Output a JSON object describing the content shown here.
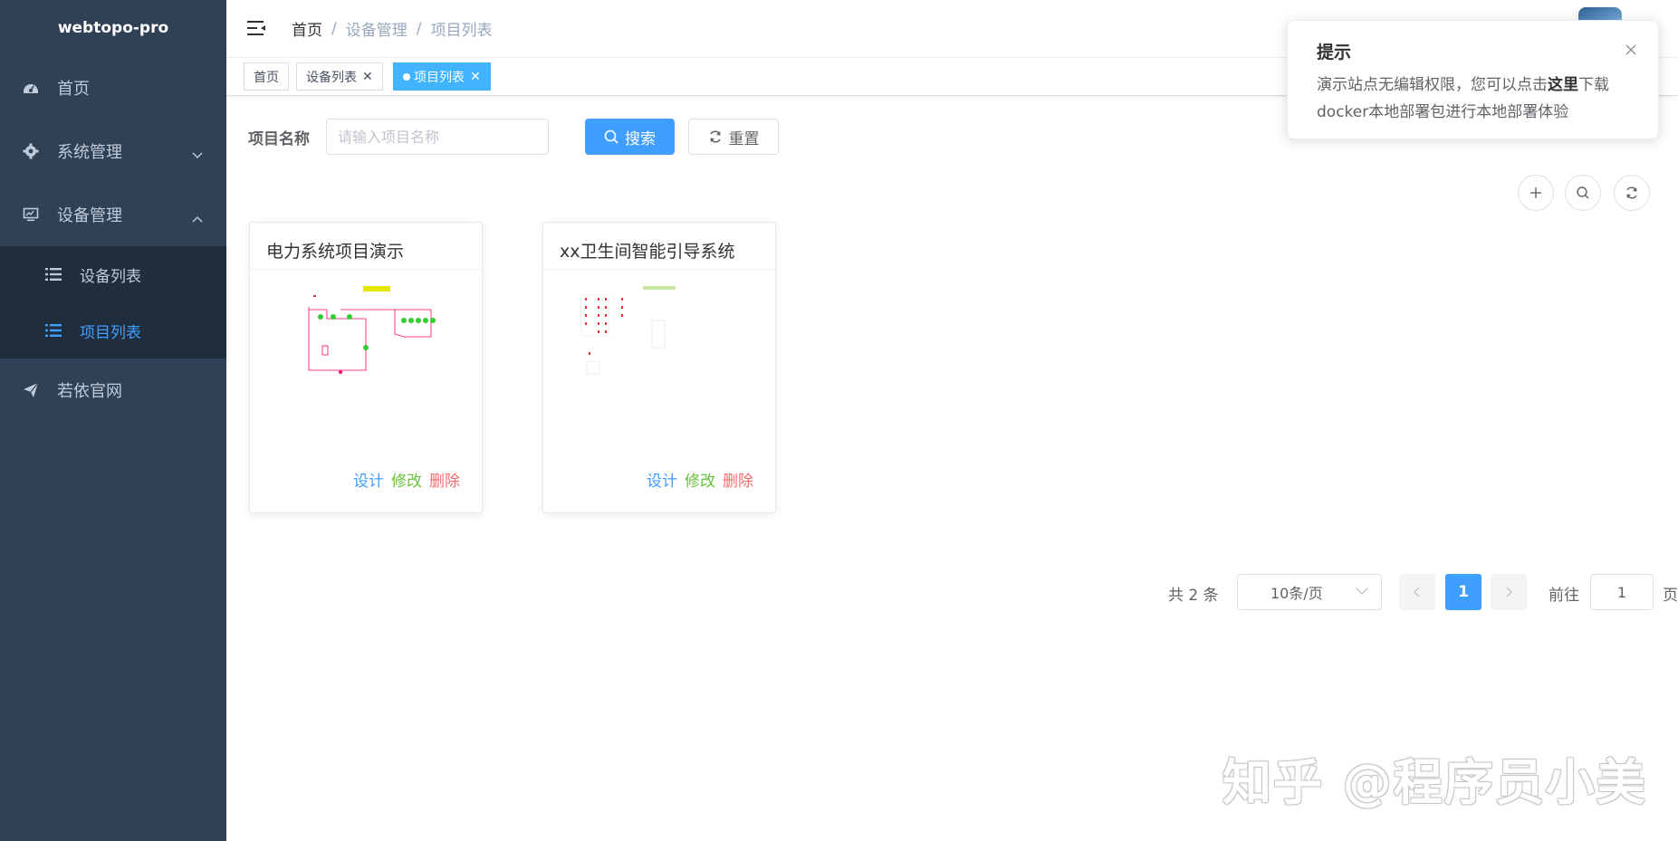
{
  "app": {
    "brand": "webtopo-pro"
  },
  "sidebar": {
    "items": [
      {
        "label": "首页",
        "icon": "dashboard-icon"
      },
      {
        "label": "系统管理",
        "icon": "gear-icon"
      },
      {
        "label": "设备管理",
        "icon": "monitor-icon",
        "expanded": true,
        "children": [
          {
            "label": "设备列表",
            "icon": "list-icon"
          },
          {
            "label": "项目列表",
            "icon": "list-icon",
            "active": true
          }
        ]
      },
      {
        "label": "若依官网",
        "icon": "send-icon"
      }
    ]
  },
  "navbar": {
    "breadcrumb": [
      "首页",
      "设备管理",
      "项目列表"
    ],
    "separator": "/"
  },
  "tags": [
    {
      "label": "首页",
      "closable": false
    },
    {
      "label": "设备列表",
      "closable": true
    },
    {
      "label": "项目列表",
      "closable": true,
      "active": true
    }
  ],
  "search": {
    "label": "项目名称",
    "placeholder": "请输入项目名称",
    "value": "",
    "search_button": "搜索",
    "reset_button": "重置"
  },
  "toolbar": {
    "icons": [
      "plus-icon",
      "search-icon",
      "refresh-icon"
    ]
  },
  "cards": [
    {
      "title": "电力系统项目演示",
      "actions": {
        "design": "设计",
        "edit": "修改",
        "delete": "删除"
      }
    },
    {
      "title": "xx卫生间智能引导系统",
      "actions": {
        "design": "设计",
        "edit": "修改",
        "delete": "删除"
      }
    }
  ],
  "pagination": {
    "total_text": "共 2 条",
    "page_size": "10条/页",
    "current_page": "1",
    "goto_label": "前往",
    "goto_value": "1",
    "goto_unit": "页"
  },
  "notification": {
    "title": "提示",
    "text_before": "演示站点无编辑权限，您可以点击",
    "link_text": "这里",
    "text_after": "下载docker本地部署包进行本地部署体验"
  },
  "watermark": "知乎 @程序员小美",
  "colors": {
    "sidebar_bg": "#304156",
    "submenu_bg": "#1f2d3d",
    "primary": "#409eff",
    "success": "#67c23a",
    "danger": "#f56c6c"
  }
}
